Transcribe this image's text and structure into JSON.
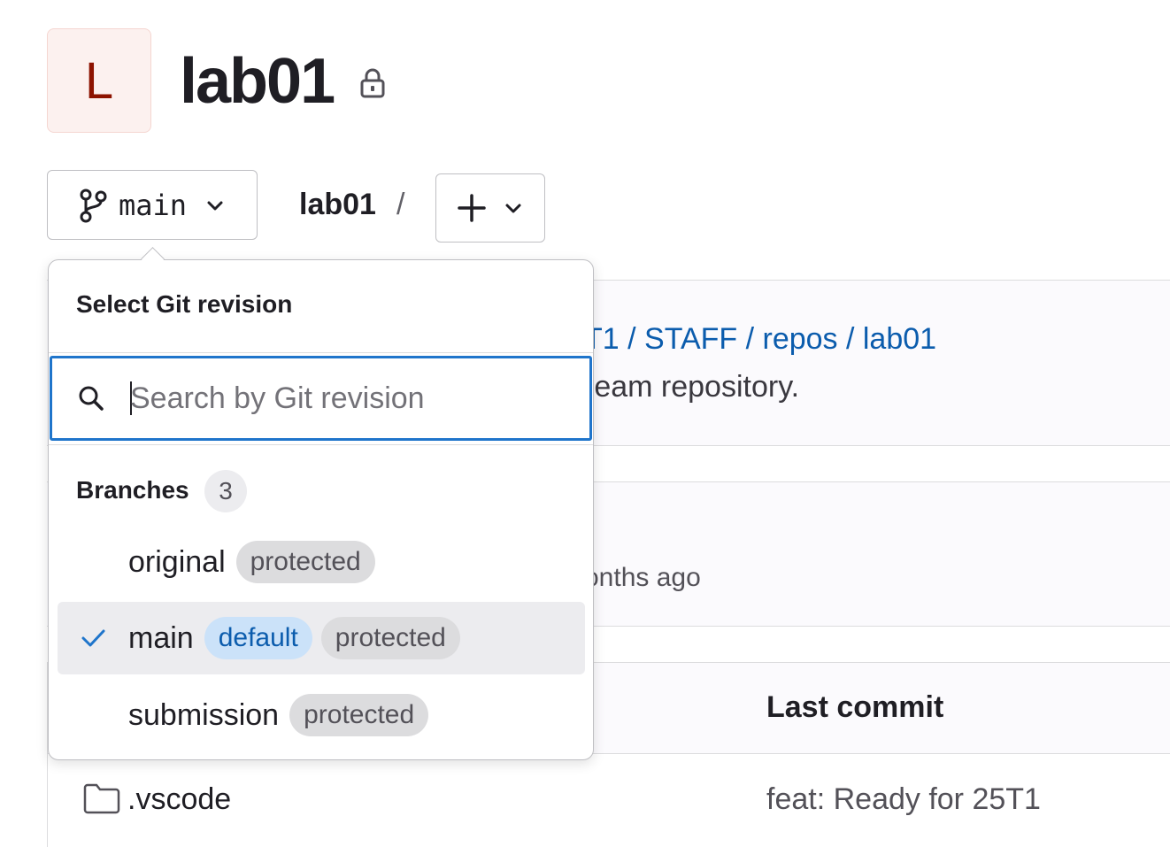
{
  "project": {
    "avatar_letter": "L",
    "name": "lab01",
    "visibility_icon": "lock-icon"
  },
  "toolbar": {
    "branch_label": "main",
    "breadcrumb_repo": "lab01",
    "breadcrumb_separator": "/"
  },
  "background": {
    "fork_path": "T1 / STAFF / repos / lab01",
    "fork_desc": "ream repository.",
    "commit_time": "onths ago",
    "table_header_last_commit": "Last commit",
    "file_name": ".vscode",
    "file_last_commit": "feat: Ready for 25T1"
  },
  "dropdown": {
    "title": "Select Git revision",
    "search_placeholder": "Search by Git revision",
    "search_value": "",
    "group_label": "Branches",
    "group_count": "3",
    "items": [
      {
        "name": "original",
        "badges": [
          "protected"
        ],
        "selected": false
      },
      {
        "name": "main",
        "badges": [
          "default",
          "protected"
        ],
        "selected": true
      },
      {
        "name": "submission",
        "badges": [
          "protected"
        ],
        "selected": false
      }
    ]
  },
  "colors": {
    "accent": "#1f75cb",
    "link": "#0b5cad",
    "avatar_bg": "#fcf1ef",
    "avatar_text": "#8d1300"
  }
}
